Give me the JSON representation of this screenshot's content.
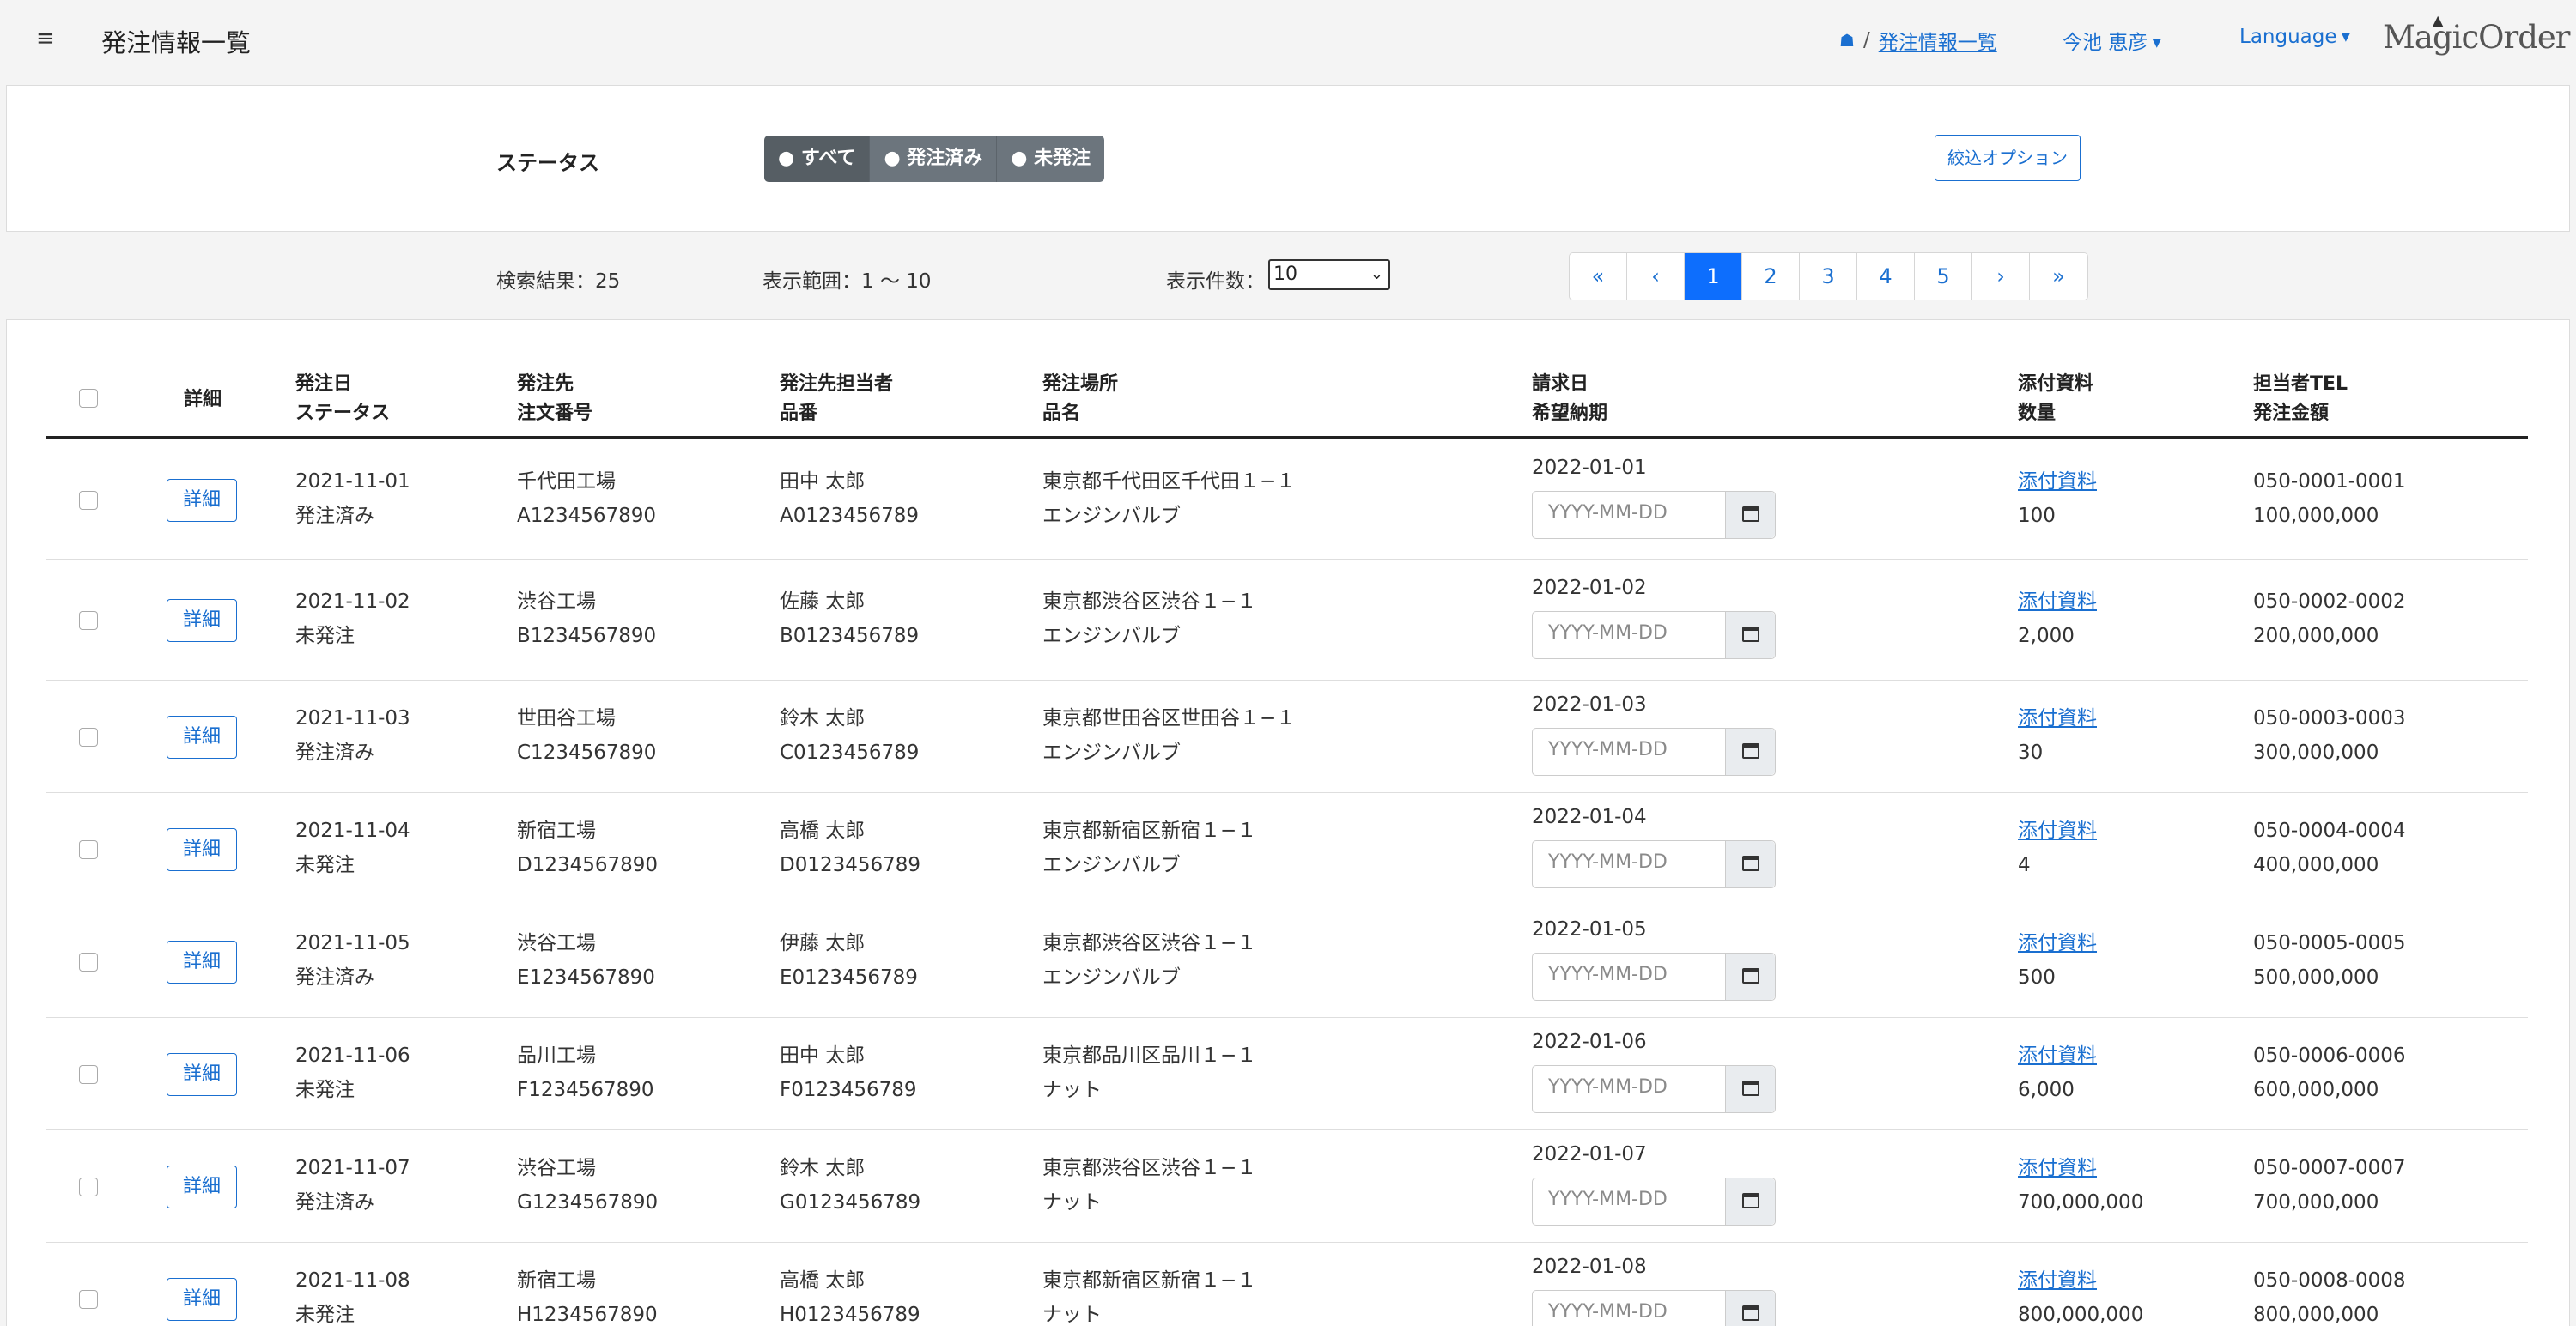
{
  "header": {
    "menu_icon": "≡",
    "title": "発注情報一覧",
    "breadcrumb_current": "発注情報一覧",
    "user_name": "今池 恵彦",
    "language_label": "Language",
    "logo_text": "MagicOrder"
  },
  "filter": {
    "status_label": "ステータス",
    "status_options": [
      "● すべて",
      "● 発注済み",
      "● 未発注"
    ],
    "selected_status": "● すべて",
    "filter_options_button": "絞込オプション"
  },
  "results": {
    "count_text": "検索結果：25",
    "range_text": "表示範囲：1 〜 10",
    "per_page_label": "表示件数：",
    "per_page_value": "10",
    "pagination": [
      "«",
      "‹",
      "1",
      "2",
      "3",
      "4",
      "5",
      "›",
      "»"
    ],
    "current_page": "1"
  },
  "table": {
    "headers": {
      "detail": "詳細",
      "order_date": "発注日",
      "status": "ステータス",
      "supplier": "発注先",
      "order_no": "注文番号",
      "contact": "発注先担当者",
      "part_no": "品番",
      "location": "発注場所",
      "product": "品名",
      "invoice_date": "請求日",
      "desired_delivery": "希望納期",
      "attachment": "添付資料",
      "quantity": "数量",
      "tel": "担当者TEL",
      "amount": "発注金額"
    },
    "detail_label": "詳細",
    "attachment_label": "添付資料",
    "date_placeholder": "YYYY-MM-DD",
    "rows": [
      {
        "order_date": "2021-11-01",
        "status": "発注済み",
        "supplier": "千代田工場",
        "order_no": "A1234567890",
        "contact": "田中 太郎",
        "part_no": "A0123456789",
        "location": "東京都千代田区千代田１−１",
        "product": "エンジンバルブ",
        "invoice_date": "2022-01-01",
        "quantity": "100",
        "tel": "050-0001-0001",
        "amount": "100,000,000"
      },
      {
        "order_date": "2021-11-02",
        "status": "未発注",
        "supplier": "渋谷工場",
        "order_no": "B1234567890",
        "contact": "佐藤 太郎",
        "part_no": "B0123456789",
        "location": "東京都渋谷区渋谷１−１",
        "product": "エンジンバルブ",
        "invoice_date": "2022-01-02",
        "quantity": "2,000",
        "tel": "050-0002-0002",
        "amount": "200,000,000"
      },
      {
        "order_date": "2021-11-03",
        "status": "発注済み",
        "supplier": "世田谷工場",
        "order_no": "C1234567890",
        "contact": "鈴木 太郎",
        "part_no": "C0123456789",
        "location": "東京都世田谷区世田谷１−１",
        "product": "エンジンバルブ",
        "invoice_date": "2022-01-03",
        "quantity": "30",
        "tel": "050-0003-0003",
        "amount": "300,000,000"
      },
      {
        "order_date": "2021-11-04",
        "status": "未発注",
        "supplier": "新宿工場",
        "order_no": "D1234567890",
        "contact": "高橋 太郎",
        "part_no": "D0123456789",
        "location": "東京都新宿区新宿１−１",
        "product": "エンジンバルブ",
        "invoice_date": "2022-01-04",
        "quantity": "4",
        "tel": "050-0004-0004",
        "amount": "400,000,000"
      },
      {
        "order_date": "2021-11-05",
        "status": "発注済み",
        "supplier": "渋谷工場",
        "order_no": "E1234567890",
        "contact": "伊藤 太郎",
        "part_no": "E0123456789",
        "location": "東京都渋谷区渋谷１−１",
        "product": "エンジンバルブ",
        "invoice_date": "2022-01-05",
        "quantity": "500",
        "tel": "050-0005-0005",
        "amount": "500,000,000"
      },
      {
        "order_date": "2021-11-06",
        "status": "未発注",
        "supplier": "品川工場",
        "order_no": "F1234567890",
        "contact": "田中 太郎",
        "part_no": "F0123456789",
        "location": "東京都品川区品川１−１",
        "product": "ナット",
        "invoice_date": "2022-01-06",
        "quantity": "6,000",
        "tel": "050-0006-0006",
        "amount": "600,000,000"
      },
      {
        "order_date": "2021-11-07",
        "status": "発注済み",
        "supplier": "渋谷工場",
        "order_no": "G1234567890",
        "contact": "鈴木 太郎",
        "part_no": "G0123456789",
        "location": "東京都渋谷区渋谷１−１",
        "product": "ナット",
        "invoice_date": "2022-01-07",
        "quantity": "700,000,000",
        "tel": "050-0007-0007",
        "amount": "700,000,000"
      },
      {
        "order_date": "2021-11-08",
        "status": "未発注",
        "supplier": "新宿工場",
        "order_no": "H1234567890",
        "contact": "高橋 太郎",
        "part_no": "H0123456789",
        "location": "東京都新宿区新宿１−１",
        "product": "ナット",
        "invoice_date": "2022-01-08",
        "quantity": "800,000,000",
        "tel": "050-0008-0008",
        "amount": "800,000,000"
      }
    ]
  },
  "colors": {
    "accent": "#0d6efd",
    "link": "#1a6fd0",
    "segment_bg": "#6c757d"
  }
}
